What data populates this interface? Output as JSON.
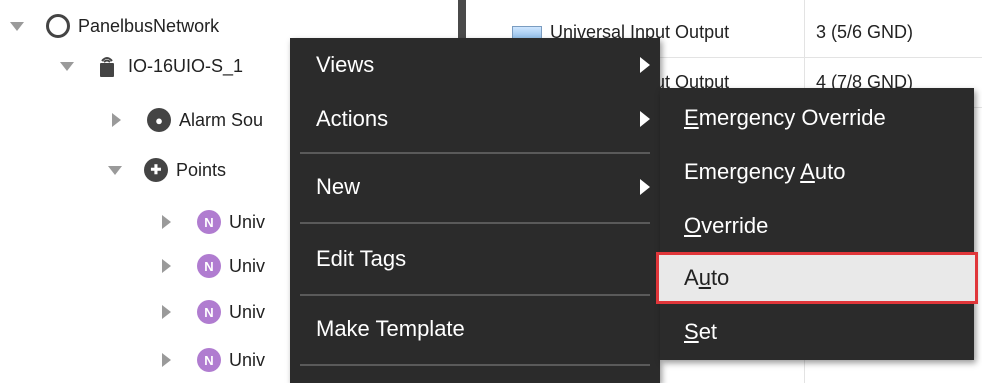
{
  "tree": {
    "items": [
      {
        "label": "PanelbusNetwork",
        "icon": "network-icon"
      },
      {
        "label": "IO-16UIO-S_1",
        "icon": "device-icon"
      },
      {
        "label": "Alarm Sou",
        "icon": "alarm-icon"
      },
      {
        "label": "Points",
        "icon": "points-icon"
      },
      {
        "label": "Univ",
        "icon": "n-point-icon",
        "badge": "N"
      },
      {
        "label": "Univ",
        "icon": "n-point-icon",
        "badge": "N"
      },
      {
        "label": "Univ",
        "icon": "n-point-icon",
        "badge": "N"
      },
      {
        "label": "Univ",
        "icon": "n-point-icon",
        "badge": "N"
      }
    ]
  },
  "table": {
    "rows": [
      {
        "type": "Universal Input Output",
        "terminal": "3 (5/6 GND)"
      },
      {
        "type": "Universal Input Output",
        "terminal": "4 (7/8 GND)"
      }
    ]
  },
  "context_menu": {
    "items": [
      {
        "label": "Views",
        "has_submenu": true
      },
      {
        "label": "Actions",
        "has_submenu": true
      },
      {
        "label": "New",
        "has_submenu": true
      },
      {
        "label": "Edit Tags",
        "has_submenu": false
      },
      {
        "label": "Make Template",
        "has_submenu": false
      }
    ]
  },
  "actions_submenu": {
    "items": [
      {
        "pre": "",
        "u": "E",
        "post": "mergency Override"
      },
      {
        "pre": "Emergency ",
        "u": "A",
        "post": "uto"
      },
      {
        "pre": "",
        "u": "O",
        "post": "verride"
      },
      {
        "pre": "A",
        "u": "u",
        "post": "to",
        "highlighted": true
      },
      {
        "pre": "",
        "u": "S",
        "post": "et"
      }
    ]
  },
  "colors": {
    "menu_bg": "#2b2b2b",
    "highlight_border": "#e0363a",
    "highlight_bg": "#e9e9e9",
    "n_icon": "#b07cd0"
  }
}
